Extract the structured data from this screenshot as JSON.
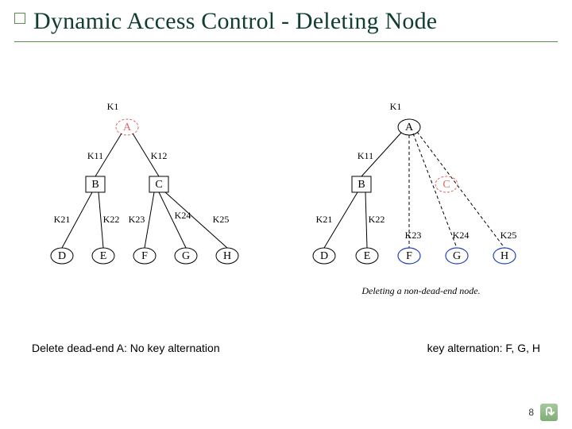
{
  "title": "Dynamic Access Control - Deleting Node",
  "page_number": "8",
  "caption_left": "Delete dead-end A: No key alternation",
  "caption_right": "key alternation: F, G, H",
  "figure_caption": "Deleting a non-dead-end node.",
  "left": {
    "root_key": "K1",
    "keys": {
      "ab": "K11",
      "ac": "K12",
      "bd": "K21",
      "be": "K22",
      "cf": "K23",
      "cg": "K24",
      "ch": "K25"
    },
    "nodes": {
      "A": "A",
      "B": "B",
      "C": "C",
      "D": "D",
      "E": "E",
      "F": "F",
      "G": "G",
      "H": "H"
    }
  },
  "right": {
    "root_key": "K1",
    "keys": {
      "ab": "K11",
      "bd": "K21",
      "be": "K22",
      "cf": "K23",
      "cg": "K24",
      "ch": "K25"
    },
    "nodes": {
      "A": "A",
      "B": "B",
      "C": "C",
      "D": "D",
      "E": "E",
      "F": "F",
      "G": "G",
      "H": "H"
    }
  }
}
